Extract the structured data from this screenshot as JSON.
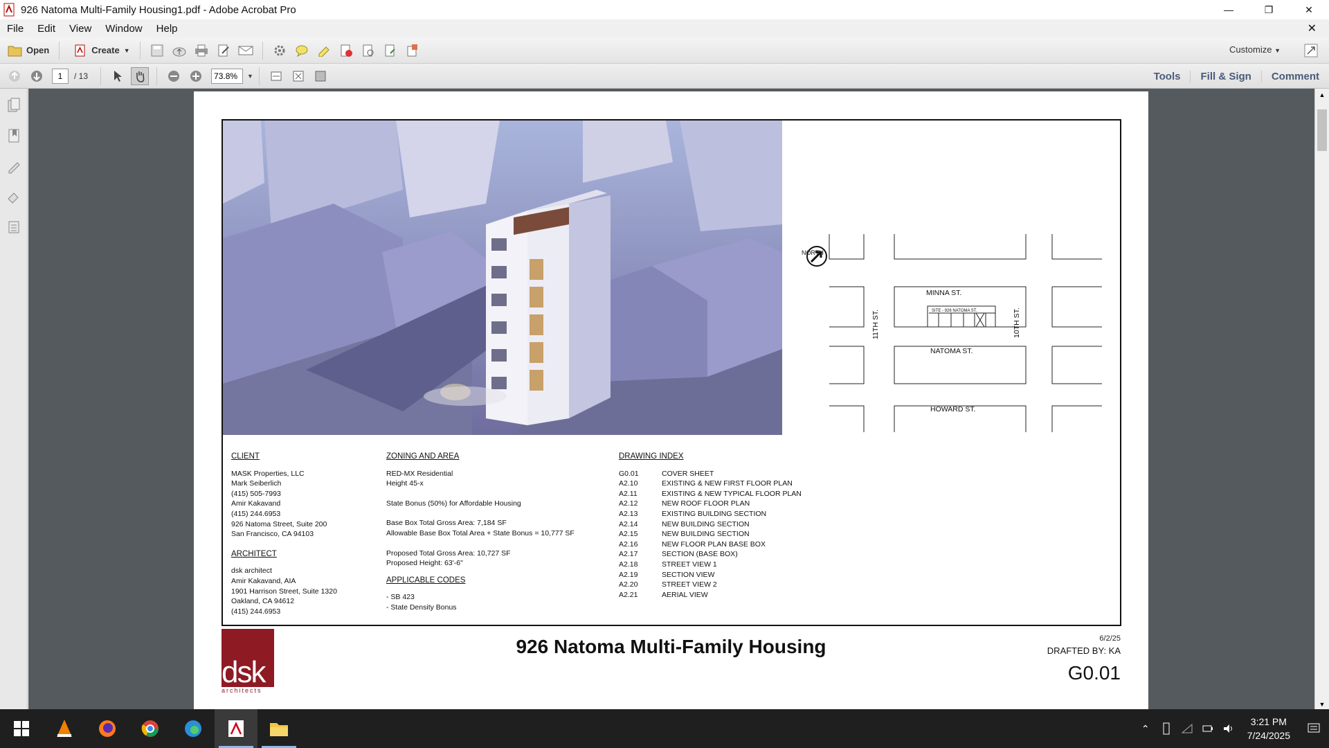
{
  "window": {
    "title": "926 Natoma Multi-Family Housing1.pdf - Adobe Acrobat Pro"
  },
  "menu": [
    "File",
    "Edit",
    "View",
    "Window",
    "Help"
  ],
  "toolbar": {
    "open_label": "Open",
    "create_label": "Create",
    "customize_label": "Customize"
  },
  "nav": {
    "page_current": "1",
    "page_total": "/ 13",
    "zoom": "73.8%"
  },
  "panels": {
    "tools": "Tools",
    "fill_sign": "Fill & Sign",
    "comment": "Comment"
  },
  "document": {
    "map": {
      "north": "NORTH",
      "minna": "MINNA ST.",
      "natoma": "NATOMA ST.",
      "howard": "HOWARD ST.",
      "eleventh": "11TH ST.",
      "tenth": "10TH ST.",
      "site": "SITE - 926 NATOMA ST."
    },
    "client": {
      "heading": "CLIENT",
      "lines": [
        "MASK Properties, LLC",
        "Mark Seiberlich",
        "(415) 505-7993",
        "Amir Kakavand",
        "(415) 244.6953",
        "926 Natoma Street, Suite 200",
        "San Francisco, CA 94103"
      ]
    },
    "architect": {
      "heading": "ARCHITECT",
      "lines": [
        "dsk architect",
        "Amir Kakavand, AIA",
        "1901 Harrison Street, Suite 1320",
        "Oakland, CA 94612",
        "(415) 244.6953"
      ]
    },
    "zoning": {
      "heading": "ZONING AND AREA",
      "l1": "RED-MX Residential",
      "l2": "Height 45-x",
      "l3": "State Bonus (50%) for Affordable Housing",
      "l4": "Base Box Total Gross Area: 7,184 SF",
      "l5": "Allowable Base Box Total Area + State Bonus = 10,777 SF",
      "l6": "Proposed Total Gross Area: 10,727 SF",
      "l7": "Proposed Height:  63'-6\""
    },
    "codes": {
      "heading": "APPLICABLE CODES",
      "lines": [
        "- SB 423",
        "- State Density Bonus"
      ]
    },
    "index": {
      "heading": "DRAWING INDEX",
      "rows": [
        {
          "code": "G0.01",
          "title": "COVER SHEET"
        },
        {
          "code": "A2.10",
          "title": "EXISTING & NEW FIRST FLOOR PLAN"
        },
        {
          "code": "A2.11",
          "title": "EXISTING & NEW TYPICAL FLOOR PLAN"
        },
        {
          "code": "A2.12",
          "title": "NEW ROOF FLOOR PLAN"
        },
        {
          "code": "A2.13",
          "title": "EXISTING BUILDING SECTION"
        },
        {
          "code": "A2.14",
          "title": "NEW BUILDING SECTION"
        },
        {
          "code": "A2.15",
          "title": "NEW BUILDING SECTION"
        },
        {
          "code": "A2.16",
          "title": "NEW FLOOR PLAN BASE BOX"
        },
        {
          "code": "A2.17",
          "title": "SECTION (BASE BOX)"
        },
        {
          "code": "A2.18",
          "title": "STREET VIEW 1"
        },
        {
          "code": "A2.19",
          "title": "SECTION VIEW"
        },
        {
          "code": "A2.20",
          "title": "STREET VIEW 2"
        },
        {
          "code": "A2.21",
          "title": "AERIAL VIEW"
        }
      ]
    },
    "title": "926 Natoma Multi-Family Housing",
    "date": "6/2/25",
    "drafted": "DRAFTED BY: KA",
    "sheet": "G0.01",
    "logo": {
      "text": "dsk",
      "sub": "architects"
    }
  },
  "clock": {
    "time": "3:21 PM",
    "date": "7/24/2025"
  }
}
